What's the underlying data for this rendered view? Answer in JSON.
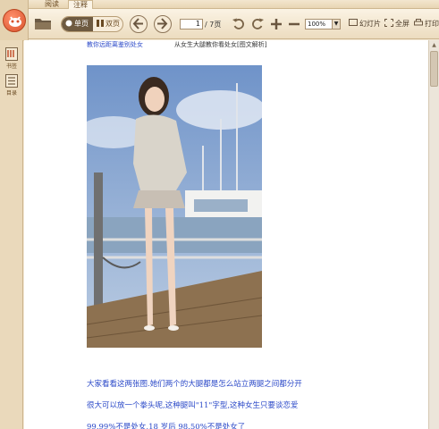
{
  "tabs": [
    {
      "label": "阅读"
    },
    {
      "label": "注释"
    }
  ],
  "toolbar": {
    "view_single_label": "单页",
    "view_double_label": "双页",
    "page_current": "1",
    "page_total": "/ 7页",
    "zoom_value": "100%",
    "slideshow_label": "幻灯片",
    "fullscreen_label": "全屏",
    "print_label": "打印"
  },
  "sidebar": {
    "items": [
      {
        "label": "书签"
      },
      {
        "label": "目录"
      }
    ]
  },
  "document": {
    "header_link": "教你远距离鉴别处女",
    "header_title": "从女生大腿教你看处女[图文解析]",
    "paragraphs": [
      "大家看看这两张图.她们两个的大腿都是怎么站立两腿之间都分开",
      "很大可以放一个拳头呢,这种腿叫\"11\"字型,这种女生只要谈恋爱",
      "99.99%不是处女,18 岁后 98.50%不是处女了"
    ]
  },
  "colors": {
    "link_blue": "#2b49c8",
    "toolbar_bg": "#f4e9d6",
    "logo_red": "#d9532d"
  }
}
